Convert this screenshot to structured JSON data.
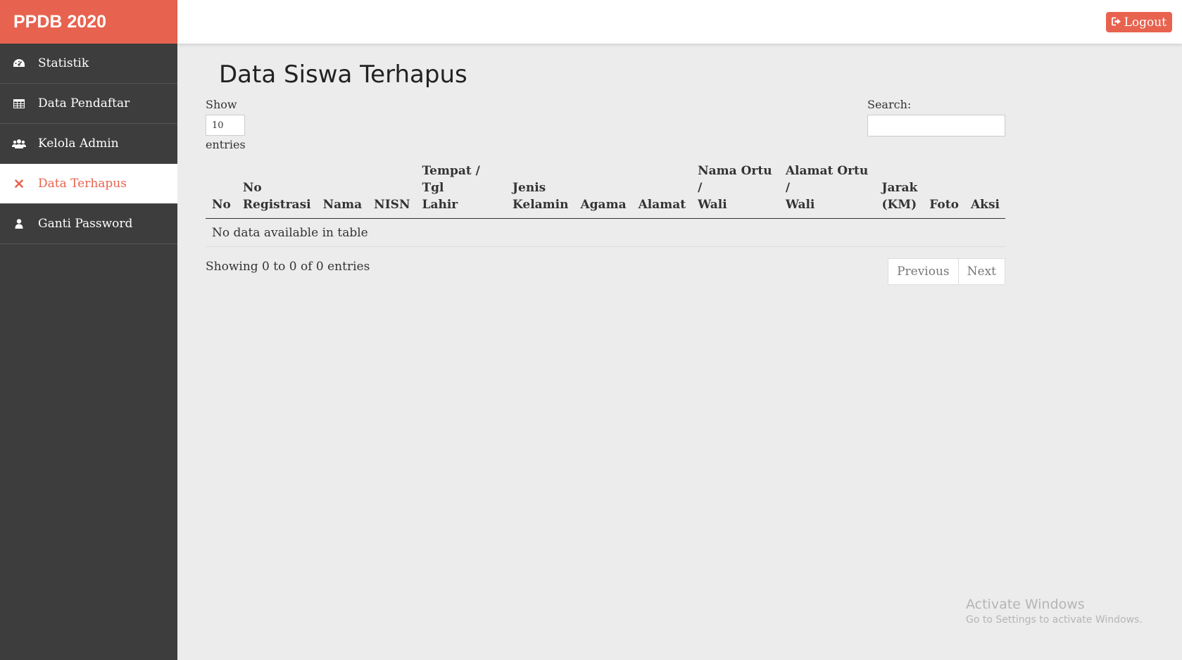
{
  "brand": "PPDB 2020",
  "sidebar": {
    "items": [
      {
        "label": "Statistik",
        "icon": "dashboard-icon"
      },
      {
        "label": "Data Pendaftar",
        "icon": "table-icon"
      },
      {
        "label": "Kelola Admin",
        "icon": "users-icon"
      },
      {
        "label": "Data Terhapus",
        "icon": "close-icon",
        "active": true
      },
      {
        "label": "Ganti Password",
        "icon": "user-icon"
      }
    ]
  },
  "topbar": {
    "logout_label": "Logout"
  },
  "main": {
    "title": "Data Siswa Terhapus",
    "show_label": "Show",
    "length_value": "10",
    "entries_label": "entries",
    "search_label": "Search:",
    "search_value": "",
    "table": {
      "headers": [
        {
          "line1": "",
          "line2": "No"
        },
        {
          "line1": "No",
          "line2": "Registrasi"
        },
        {
          "line1": "",
          "line2": "Nama"
        },
        {
          "line1": "",
          "line2": "NISN"
        },
        {
          "line1": "Tempat / Tgl",
          "line2": "Lahir"
        },
        {
          "line1": "Jenis",
          "line2": "Kelamin"
        },
        {
          "line1": "",
          "line2": "Agama"
        },
        {
          "line1": "",
          "line2": "Alamat"
        },
        {
          "line1": "Nama Ortu /",
          "line2": "Wali"
        },
        {
          "line1": "Alamat Ortu /",
          "line2": "Wali"
        },
        {
          "line1": "Jarak",
          "line2": "(KM)"
        },
        {
          "line1": "",
          "line2": "Foto"
        },
        {
          "line1": "",
          "line2": "Aksi"
        }
      ],
      "empty_message": "No data available in table"
    },
    "info": "Showing 0 to 0 of 0 entries",
    "pagination": {
      "previous": "Previous",
      "next": "Next"
    }
  },
  "watermark": {
    "line1": "Activate Windows",
    "line2": "Go to Settings to activate Windows."
  },
  "colors": {
    "accent": "#e8634f",
    "sidebar_bg": "#3d3d3d",
    "content_bg": "#ececec"
  }
}
